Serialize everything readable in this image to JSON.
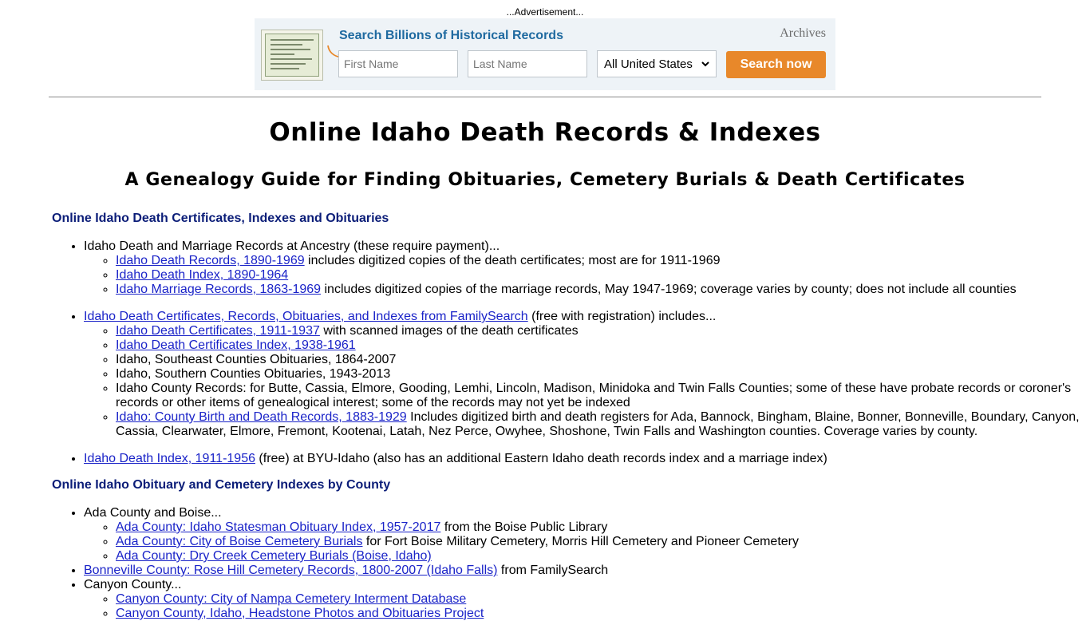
{
  "ad": {
    "label": "...Advertisement...",
    "headline": "Search Billions of Historical Records",
    "brand": "Archives",
    "first_name_placeholder": "First Name",
    "last_name_placeholder": "Last Name",
    "location_selected": "All United States",
    "search_button": "Search now",
    "accent_color": "#e8882a"
  },
  "page": {
    "title": "Online Idaho Death Records & Indexes",
    "subtitle": "A Genealogy Guide for Finding Obituaries, Cemetery Burials & Death Certificates"
  },
  "sections": [
    {
      "heading": "Online Idaho Death Certificates, Indexes and Obituaries",
      "items": [
        {
          "text": "Idaho Death and Marriage Records at Ancestry (these require payment)...",
          "children": [
            {
              "link": "Idaho Death Records, 1890-1969",
              "text": " includes digitized copies of the death certificates; most are for 1911-1969"
            },
            {
              "link": "Idaho Death Index, 1890-1964",
              "text": ""
            },
            {
              "link": "Idaho Marriage Records, 1863-1969",
              "text": " includes digitized copies of the marriage records, May 1947-1969; coverage varies by county; does not include all counties"
            }
          ]
        },
        {
          "link": "Idaho Death Certificates, Records, Obituaries, and Indexes from FamilySearch",
          "text": " (free with registration) includes...",
          "children": [
            {
              "link": "Idaho Death Certificates, 1911-1937",
              "text": " with scanned images of the death certificates"
            },
            {
              "link": "Idaho Death Certificates Index, 1938-1961",
              "text": ""
            },
            {
              "link": "",
              "text": "Idaho, Southeast Counties Obituaries, 1864-2007"
            },
            {
              "link": "",
              "text": "Idaho, Southern Counties Obituaries, 1943-2013"
            },
            {
              "link": "",
              "text": "Idaho County Records: for Butte, Cassia, Elmore, Gooding, Lemhi, Lincoln, Madison, Minidoka and Twin Falls Counties; some of these have probate records or coroner's records or other items of genealogical interest; some of the records may not yet be indexed"
            },
            {
              "link": "Idaho: County Birth and Death Records, 1883-1929",
              "text": " Includes digitized birth and death registers for Ada, Bannock, Bingham, Blaine, Bonner, Bonneville, Boundary, Canyon, Cassia, Clearwater, Elmore, Fremont, Kootenai, Latah, Nez Perce, Owyhee, Shoshone, Twin Falls and Washington counties. Coverage varies by county."
            }
          ]
        },
        {
          "link": "Idaho Death Index, 1911-1956",
          "text": " (free) at BYU-Idaho (also has an additional Eastern Idaho death records index and a marriage index)",
          "children": []
        }
      ]
    },
    {
      "heading": "Online Idaho Obituary and Cemetery Indexes by County",
      "items": [
        {
          "text": "Ada County and Boise...",
          "children": [
            {
              "link": "Ada County: Idaho Statesman Obituary Index, 1957-2017",
              "text": " from the Boise Public Library"
            },
            {
              "link": "Ada County: City of Boise Cemetery Burials",
              "text": " for Fort Boise Military Cemetery, Morris Hill Cemetery and Pioneer Cemetery"
            },
            {
              "link": "Ada County: Dry Creek Cemetery Burials (Boise, Idaho)",
              "text": ""
            }
          ]
        },
        {
          "link": "Bonneville County: Rose Hill Cemetery Records, 1800-2007 (Idaho Falls)",
          "text": " from FamilySearch",
          "children": []
        },
        {
          "text": "Canyon County...",
          "children": [
            {
              "link": "Canyon County: City of Nampa Cemetery Interment Database",
              "text": ""
            },
            {
              "link": "Canyon County, Idaho, Headstone Photos and Obituaries Project",
              "text": ""
            }
          ]
        }
      ]
    }
  ]
}
